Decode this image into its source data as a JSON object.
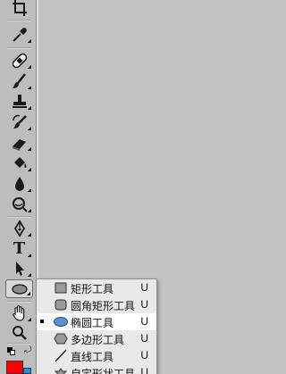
{
  "toolbar": {
    "tools": [
      {
        "name": "crop-tool",
        "icon": "crop-icon"
      },
      {
        "name": "eyedropper-tool",
        "icon": "eyedropper-icon"
      },
      {
        "name": "healing-brush-tool",
        "icon": "bandage-icon"
      },
      {
        "name": "brush-tool",
        "icon": "brush-icon"
      },
      {
        "name": "clone-stamp-tool",
        "icon": "stamp-icon"
      },
      {
        "name": "history-brush-tool",
        "icon": "history-brush-icon"
      },
      {
        "name": "eraser-tool",
        "icon": "eraser-icon"
      },
      {
        "name": "paint-bucket-tool",
        "icon": "bucket-icon"
      },
      {
        "name": "blur-tool",
        "icon": "drop-icon"
      },
      {
        "name": "dodge-tool",
        "icon": "dodge-icon"
      },
      {
        "name": "pen-tool",
        "icon": "pen-icon"
      },
      {
        "name": "type-tool",
        "icon": "type-icon",
        "glyph": "T"
      },
      {
        "name": "path-selection-tool",
        "icon": "arrow-icon"
      },
      {
        "name": "shape-tool",
        "icon": "ellipse-icon",
        "active": true
      },
      {
        "name": "hand-tool",
        "icon": "hand-icon"
      },
      {
        "name": "zoom-tool",
        "icon": "zoom-icon"
      }
    ]
  },
  "flyout": {
    "items": [
      {
        "label": "矩形工具",
        "key": "U",
        "icon": "rectangle-icon",
        "selected": false
      },
      {
        "label": "圆角矩形工具",
        "key": "U",
        "icon": "rounded-rectangle-icon",
        "selected": false
      },
      {
        "label": "椭圆工具",
        "key": "U",
        "icon": "ellipse-icon",
        "selected": true
      },
      {
        "label": "多边形工具",
        "key": "U",
        "icon": "polygon-icon",
        "selected": false
      },
      {
        "label": "直线工具",
        "key": "U",
        "icon": "line-icon",
        "selected": false
      },
      {
        "label": "自定形状工具",
        "key": "U",
        "icon": "custom-shape-icon",
        "selected": false
      }
    ]
  },
  "colors": {
    "foreground": "#ff0000",
    "background": "#1e90ff",
    "selected_ellipse": "#5b8fd0"
  }
}
